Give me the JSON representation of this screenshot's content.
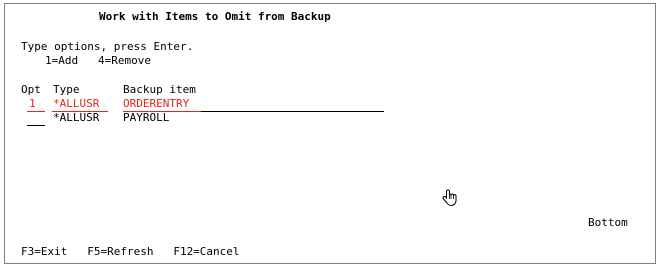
{
  "screen": {
    "title": "Work with Items to Omit from Backup",
    "instructions": "Type options, press Enter.",
    "options_line": "1=Add   4=Remove",
    "columns": {
      "opt": "Opt",
      "type": "Type",
      "item": "Backup item"
    },
    "rows": [
      {
        "opt": "1",
        "type": "*ALLUSR",
        "item": "ORDERENTRY"
      },
      {
        "opt": "",
        "type": "*ALLUSR",
        "item": "PAYROLL"
      }
    ],
    "status": "Bottom",
    "function_keys": "F3=Exit   F5=Refresh   F12=Cancel"
  },
  "colors": {
    "highlight": "#e8221c"
  },
  "icons": {
    "pointer": "hand-pointer-icon"
  }
}
